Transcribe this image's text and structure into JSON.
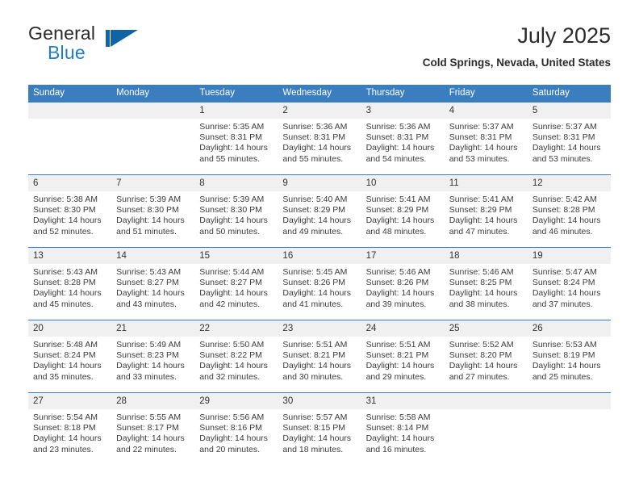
{
  "brand": {
    "name_primary": "General",
    "name_secondary": "Blue",
    "logo_icon": "flag-triangle-icon",
    "accent_color": "#1263a5"
  },
  "header": {
    "title": "July 2025",
    "subtitle": "Cold Springs, Nevada, United States"
  },
  "calendar": {
    "header_color": "#3a7ebf",
    "daynum_band_color": "#f0f0f0",
    "weekday_headers": [
      "Sunday",
      "Monday",
      "Tuesday",
      "Wednesday",
      "Thursday",
      "Friday",
      "Saturday"
    ],
    "weeks": [
      [
        {
          "day": "",
          "sunrise": "",
          "sunset": "",
          "daylight": ""
        },
        {
          "day": "",
          "sunrise": "",
          "sunset": "",
          "daylight": ""
        },
        {
          "day": "1",
          "sunrise": "Sunrise: 5:35 AM",
          "sunset": "Sunset: 8:31 PM",
          "daylight": "Daylight: 14 hours and 55 minutes."
        },
        {
          "day": "2",
          "sunrise": "Sunrise: 5:36 AM",
          "sunset": "Sunset: 8:31 PM",
          "daylight": "Daylight: 14 hours and 55 minutes."
        },
        {
          "day": "3",
          "sunrise": "Sunrise: 5:36 AM",
          "sunset": "Sunset: 8:31 PM",
          "daylight": "Daylight: 14 hours and 54 minutes."
        },
        {
          "day": "4",
          "sunrise": "Sunrise: 5:37 AM",
          "sunset": "Sunset: 8:31 PM",
          "daylight": "Daylight: 14 hours and 53 minutes."
        },
        {
          "day": "5",
          "sunrise": "Sunrise: 5:37 AM",
          "sunset": "Sunset: 8:31 PM",
          "daylight": "Daylight: 14 hours and 53 minutes."
        }
      ],
      [
        {
          "day": "6",
          "sunrise": "Sunrise: 5:38 AM",
          "sunset": "Sunset: 8:30 PM",
          "daylight": "Daylight: 14 hours and 52 minutes."
        },
        {
          "day": "7",
          "sunrise": "Sunrise: 5:39 AM",
          "sunset": "Sunset: 8:30 PM",
          "daylight": "Daylight: 14 hours and 51 minutes."
        },
        {
          "day": "8",
          "sunrise": "Sunrise: 5:39 AM",
          "sunset": "Sunset: 8:30 PM",
          "daylight": "Daylight: 14 hours and 50 minutes."
        },
        {
          "day": "9",
          "sunrise": "Sunrise: 5:40 AM",
          "sunset": "Sunset: 8:29 PM",
          "daylight": "Daylight: 14 hours and 49 minutes."
        },
        {
          "day": "10",
          "sunrise": "Sunrise: 5:41 AM",
          "sunset": "Sunset: 8:29 PM",
          "daylight": "Daylight: 14 hours and 48 minutes."
        },
        {
          "day": "11",
          "sunrise": "Sunrise: 5:41 AM",
          "sunset": "Sunset: 8:29 PM",
          "daylight": "Daylight: 14 hours and 47 minutes."
        },
        {
          "day": "12",
          "sunrise": "Sunrise: 5:42 AM",
          "sunset": "Sunset: 8:28 PM",
          "daylight": "Daylight: 14 hours and 46 minutes."
        }
      ],
      [
        {
          "day": "13",
          "sunrise": "Sunrise: 5:43 AM",
          "sunset": "Sunset: 8:28 PM",
          "daylight": "Daylight: 14 hours and 45 minutes."
        },
        {
          "day": "14",
          "sunrise": "Sunrise: 5:43 AM",
          "sunset": "Sunset: 8:27 PM",
          "daylight": "Daylight: 14 hours and 43 minutes."
        },
        {
          "day": "15",
          "sunrise": "Sunrise: 5:44 AM",
          "sunset": "Sunset: 8:27 PM",
          "daylight": "Daylight: 14 hours and 42 minutes."
        },
        {
          "day": "16",
          "sunrise": "Sunrise: 5:45 AM",
          "sunset": "Sunset: 8:26 PM",
          "daylight": "Daylight: 14 hours and 41 minutes."
        },
        {
          "day": "17",
          "sunrise": "Sunrise: 5:46 AM",
          "sunset": "Sunset: 8:26 PM",
          "daylight": "Daylight: 14 hours and 39 minutes."
        },
        {
          "day": "18",
          "sunrise": "Sunrise: 5:46 AM",
          "sunset": "Sunset: 8:25 PM",
          "daylight": "Daylight: 14 hours and 38 minutes."
        },
        {
          "day": "19",
          "sunrise": "Sunrise: 5:47 AM",
          "sunset": "Sunset: 8:24 PM",
          "daylight": "Daylight: 14 hours and 37 minutes."
        }
      ],
      [
        {
          "day": "20",
          "sunrise": "Sunrise: 5:48 AM",
          "sunset": "Sunset: 8:24 PM",
          "daylight": "Daylight: 14 hours and 35 minutes."
        },
        {
          "day": "21",
          "sunrise": "Sunrise: 5:49 AM",
          "sunset": "Sunset: 8:23 PM",
          "daylight": "Daylight: 14 hours and 33 minutes."
        },
        {
          "day": "22",
          "sunrise": "Sunrise: 5:50 AM",
          "sunset": "Sunset: 8:22 PM",
          "daylight": "Daylight: 14 hours and 32 minutes."
        },
        {
          "day": "23",
          "sunrise": "Sunrise: 5:51 AM",
          "sunset": "Sunset: 8:21 PM",
          "daylight": "Daylight: 14 hours and 30 minutes."
        },
        {
          "day": "24",
          "sunrise": "Sunrise: 5:51 AM",
          "sunset": "Sunset: 8:21 PM",
          "daylight": "Daylight: 14 hours and 29 minutes."
        },
        {
          "day": "25",
          "sunrise": "Sunrise: 5:52 AM",
          "sunset": "Sunset: 8:20 PM",
          "daylight": "Daylight: 14 hours and 27 minutes."
        },
        {
          "day": "26",
          "sunrise": "Sunrise: 5:53 AM",
          "sunset": "Sunset: 8:19 PM",
          "daylight": "Daylight: 14 hours and 25 minutes."
        }
      ],
      [
        {
          "day": "27",
          "sunrise": "Sunrise: 5:54 AM",
          "sunset": "Sunset: 8:18 PM",
          "daylight": "Daylight: 14 hours and 23 minutes."
        },
        {
          "day": "28",
          "sunrise": "Sunrise: 5:55 AM",
          "sunset": "Sunset: 8:17 PM",
          "daylight": "Daylight: 14 hours and 22 minutes."
        },
        {
          "day": "29",
          "sunrise": "Sunrise: 5:56 AM",
          "sunset": "Sunset: 8:16 PM",
          "daylight": "Daylight: 14 hours and 20 minutes."
        },
        {
          "day": "30",
          "sunrise": "Sunrise: 5:57 AM",
          "sunset": "Sunset: 8:15 PM",
          "daylight": "Daylight: 14 hours and 18 minutes."
        },
        {
          "day": "31",
          "sunrise": "Sunrise: 5:58 AM",
          "sunset": "Sunset: 8:14 PM",
          "daylight": "Daylight: 14 hours and 16 minutes."
        },
        {
          "day": "",
          "sunrise": "",
          "sunset": "",
          "daylight": ""
        },
        {
          "day": "",
          "sunrise": "",
          "sunset": "",
          "daylight": ""
        }
      ]
    ]
  }
}
